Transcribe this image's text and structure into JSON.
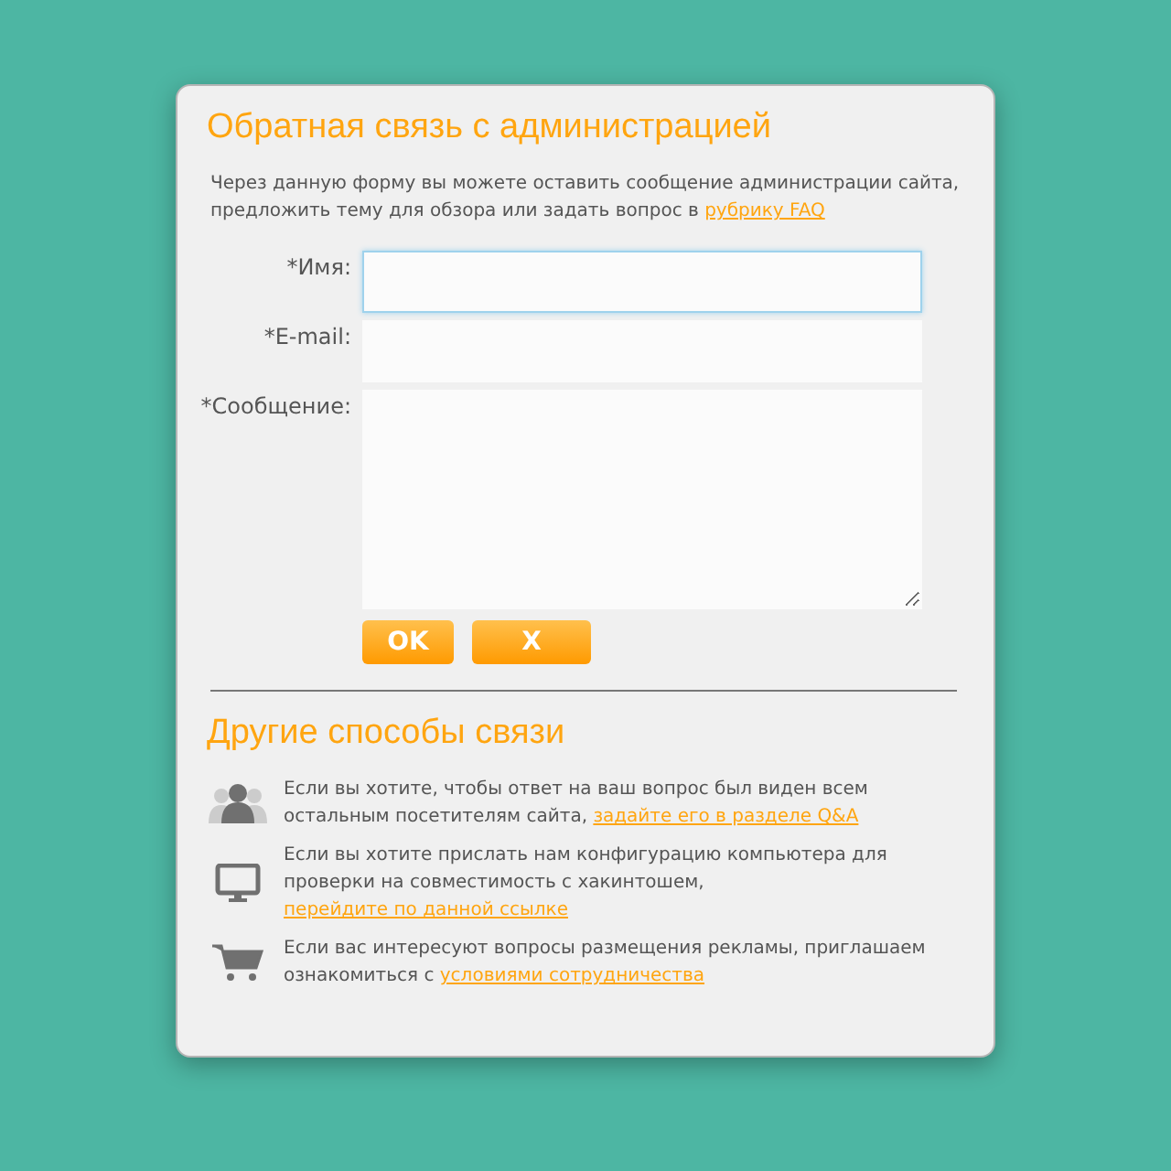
{
  "dialog": {
    "title": "Обратная связь с администрацией",
    "intro": {
      "text": "Через данную форму вы можете оставить сообщение администрации сайта, предложить тему для обзора или задать вопрос в ",
      "link": "рубрику FAQ"
    },
    "fields": [
      {
        "label": "*Имя:",
        "kind": "input",
        "focused": true
      },
      {
        "label": "*E-mail:",
        "kind": "input",
        "focused": false
      },
      {
        "label": "*Сообщение:",
        "kind": "textarea",
        "focused": false
      }
    ],
    "buttons": [
      {
        "label": "OK",
        "kind": "submit"
      },
      {
        "label": "X",
        "kind": "cancel"
      }
    ],
    "other_title": "Другие способы связи",
    "contacts": [
      {
        "kind": "people",
        "text": "Если вы хотите, чтобы ответ на ваш вопрос был виден всем остальным посетителям сайта, ",
        "link": "задайте его в разделе Q&A"
      },
      {
        "kind": "monitor",
        "text": "Если вы хотите прислать нам конфигурацию компьютера для проверки на совместимость с хакинтошем, ",
        "link": "перейдите по данной ссылке"
      },
      {
        "kind": "cart",
        "text": "Если вас интересуют вопросы размещения рекламы, приглашаем ознакомиться с ",
        "link": "условиями сотрудничества"
      }
    ]
  }
}
